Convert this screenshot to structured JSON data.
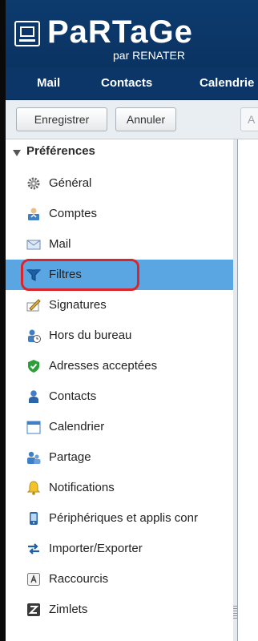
{
  "brand": {
    "name": "PaRTaGe",
    "subtitle": "par RENATER",
    "logo_icon": "monitor-icon"
  },
  "nav": [
    {
      "label": "Mail"
    },
    {
      "label": "Contacts"
    },
    {
      "label": "Calendrie"
    }
  ],
  "toolbar": {
    "save_label": "Enregistrer",
    "cancel_label": "Annuler",
    "partial_label": "A"
  },
  "preferences": {
    "title": "Préférences",
    "items": [
      {
        "label": "Général",
        "icon": "gear-icon"
      },
      {
        "label": "Comptes",
        "icon": "accounts-icon"
      },
      {
        "label": "Mail",
        "icon": "envelope-icon"
      },
      {
        "label": "Filtres",
        "icon": "filter-icon",
        "selected": true
      },
      {
        "label": "Signatures",
        "icon": "signature-icon"
      },
      {
        "label": "Hors du bureau",
        "icon": "out-of-office-icon"
      },
      {
        "label": "Adresses acceptées",
        "icon": "shield-check-icon"
      },
      {
        "label": "Contacts",
        "icon": "contact-person-icon"
      },
      {
        "label": "Calendrier",
        "icon": "calendar-icon"
      },
      {
        "label": "Partage",
        "icon": "sharing-icon"
      },
      {
        "label": "Notifications",
        "icon": "bell-icon"
      },
      {
        "label": "Périphériques et applis conr",
        "icon": "mobile-device-icon"
      },
      {
        "label": "Importer/Exporter",
        "icon": "import-export-icon"
      },
      {
        "label": "Raccourcis",
        "icon": "keyboard-key-icon"
      },
      {
        "label": "Zimlets",
        "icon": "zimlet-icon"
      }
    ]
  },
  "colors": {
    "brand_blue": "#0d3b6e",
    "selected_row": "#5aa6e3",
    "annotation_red": "#d9252c"
  }
}
